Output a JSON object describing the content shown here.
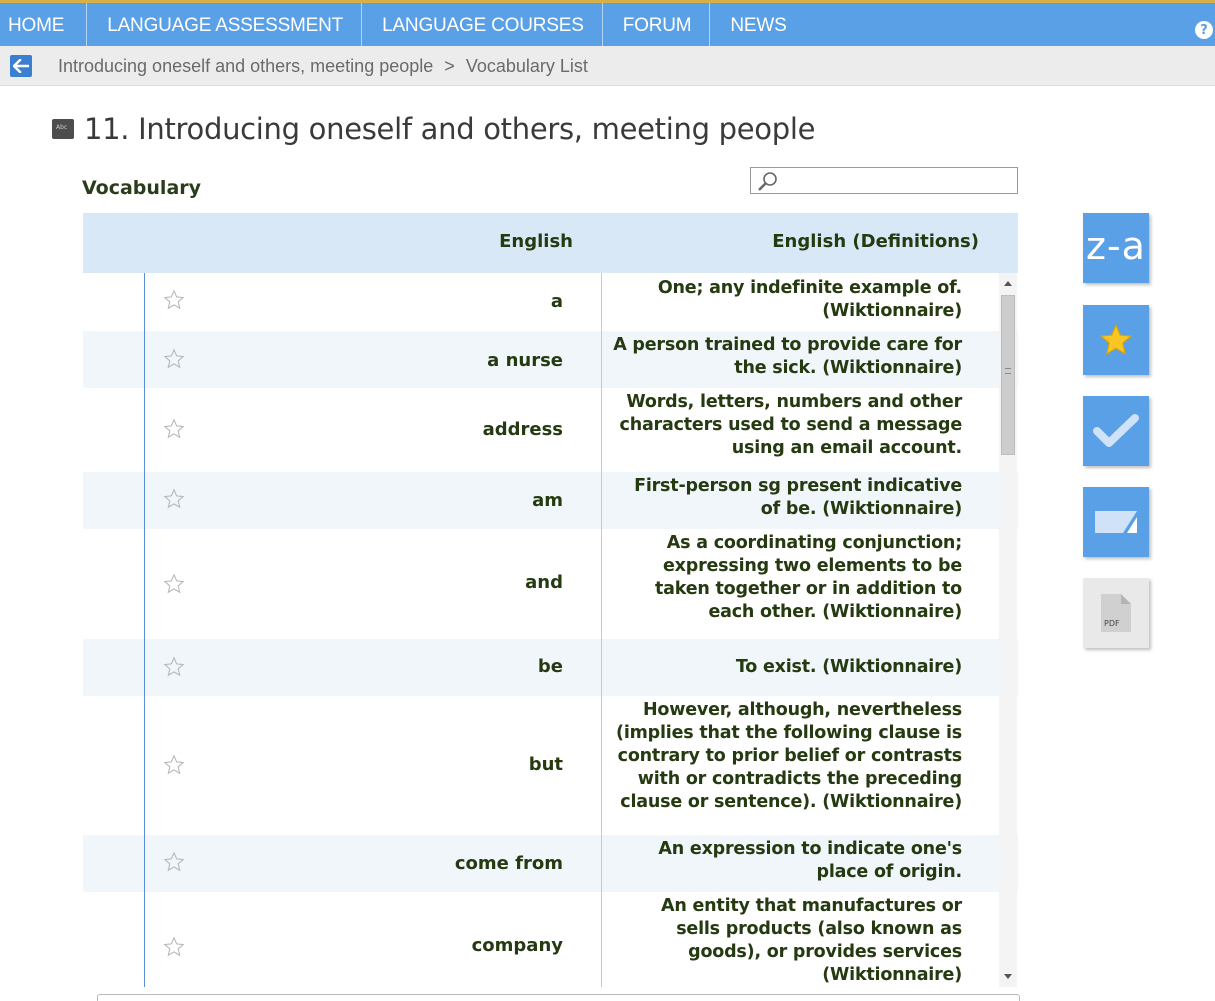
{
  "nav": {
    "items": [
      "HOME",
      "LANGUAGE ASSESSMENT",
      "LANGUAGE COURSES",
      "FORUM",
      "NEWS"
    ],
    "help_icon": "?"
  },
  "breadcrumb": {
    "items": [
      "Introducing oneself and others, meeting people",
      "Vocabulary List"
    ],
    "separator": ">"
  },
  "page": {
    "title": "11. Introducing oneself and others, meeting people",
    "section": "Vocabulary"
  },
  "search": {
    "placeholder": "",
    "value": ""
  },
  "table": {
    "headers": [
      "English",
      "English (Definitions)"
    ],
    "rows": [
      {
        "word": "a",
        "definition": "One; any indefinite example of. (Wiktionnaire)"
      },
      {
        "word": "a nurse",
        "definition": "A person trained to provide care for the sick. (Wiktionnaire)"
      },
      {
        "word": "address",
        "definition": "Words, letters, numbers and other characters used to send a message using an email account."
      },
      {
        "word": "am",
        "definition": "First-person sg present indicative of be. (Wiktionnaire)"
      },
      {
        "word": "and",
        "definition": "As a coordinating conjunction; expressing two elements to be taken together or in addition to each other. (Wiktionnaire)"
      },
      {
        "word": "be",
        "definition": "To exist. (Wiktionnaire)"
      },
      {
        "word": "but",
        "definition": "However, although, nevertheless (implies that the following clause is contrary to prior belief or contrasts with or contradicts the preceding clause or sentence). (Wiktionnaire)"
      },
      {
        "word": "come from",
        "definition": "An expression to indicate one's place of origin."
      },
      {
        "word": "company",
        "definition": "An entity that manufactures or sells products (also known as goods), or provides services (Wiktionnaire)"
      }
    ]
  },
  "tools": {
    "sort_label": "z-a",
    "pdf_label": "PDF",
    "icons": [
      "sort-za-icon",
      "star-icon",
      "check-icon",
      "flashcard-icon",
      "pdf-icon"
    ]
  },
  "colors": {
    "nav_bg": "#5aa0e6",
    "nav_top_border": "#d8b04a",
    "header_row_bg": "#d9e8f6",
    "text_green": "#253a10",
    "star_yellow": "#f9c623"
  }
}
